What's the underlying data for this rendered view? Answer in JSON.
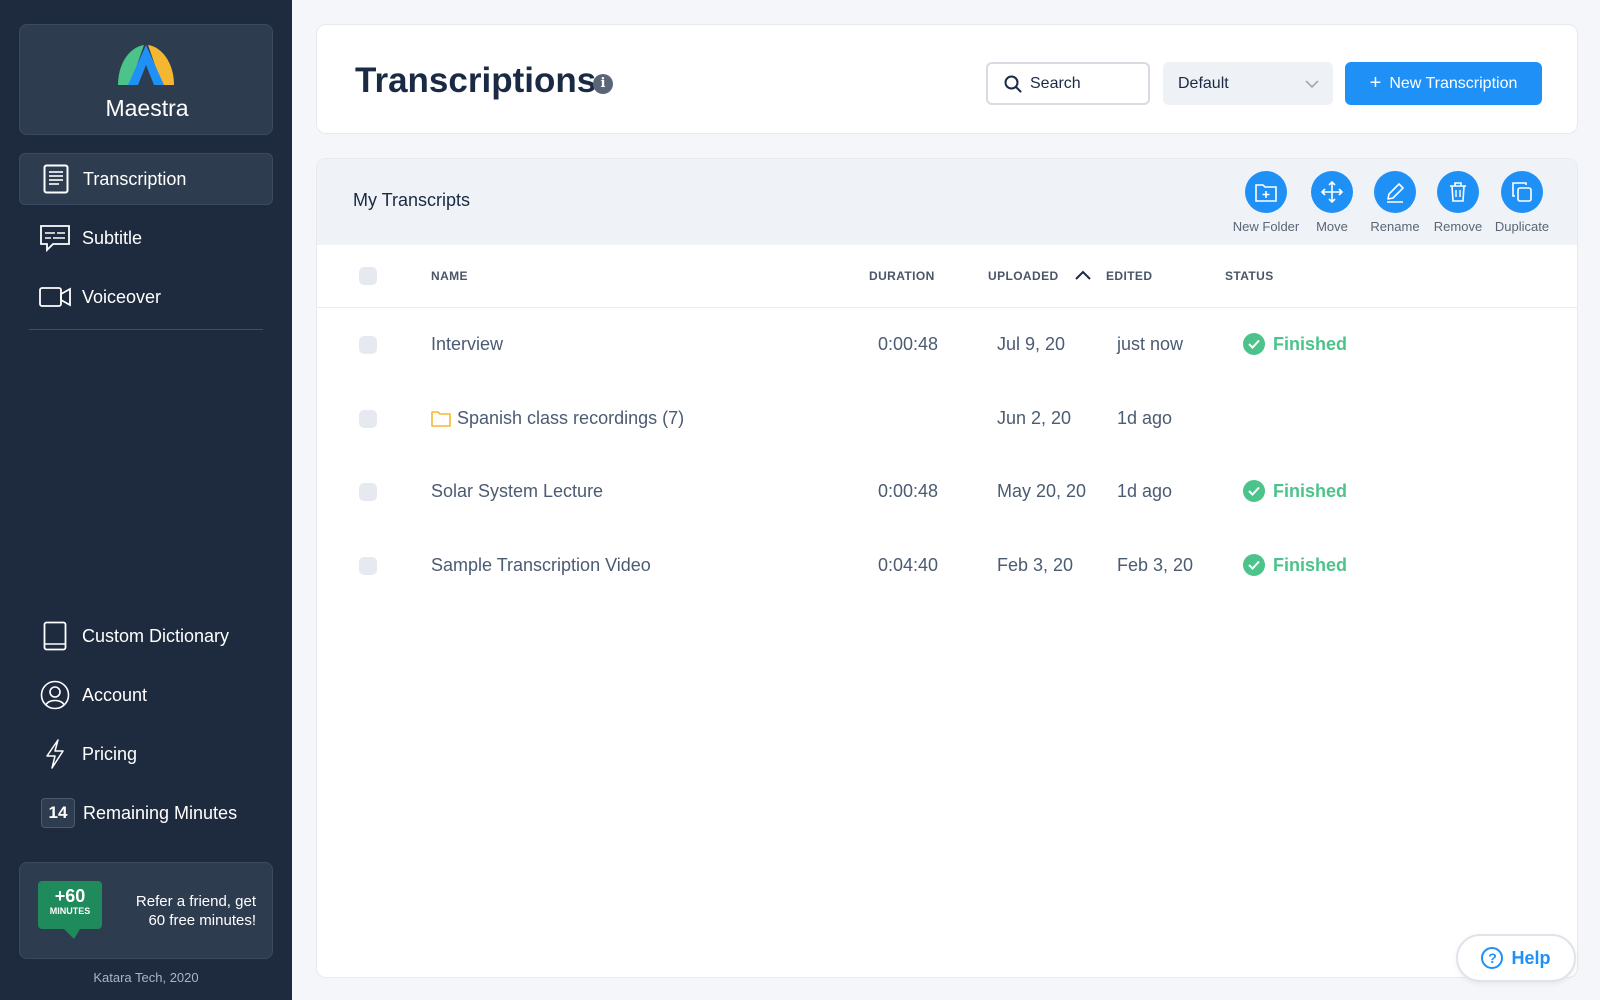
{
  "brand": {
    "name": "Maestra"
  },
  "sidebar": {
    "nav": [
      {
        "label": "Transcription",
        "icon": "document-icon",
        "active": true
      },
      {
        "label": "Subtitle",
        "icon": "subtitle-icon",
        "active": false
      },
      {
        "label": "Voiceover",
        "icon": "video-camera-icon",
        "active": false
      }
    ],
    "bottom": [
      {
        "label": "Custom Dictionary",
        "icon": "book-icon"
      },
      {
        "label": "Account",
        "icon": "user-circle-icon"
      },
      {
        "label": "Pricing",
        "icon": "lightning-icon"
      }
    ],
    "remaining": {
      "count": "14",
      "label": "Remaining Minutes"
    },
    "refer": {
      "tag_big": "+60",
      "tag_small": "MINUTES",
      "line1": "Refer a friend, get",
      "line2": "60 free minutes!"
    },
    "copyright": "Katara Tech, 2020"
  },
  "header": {
    "title": "Transcriptions",
    "info": "i",
    "search_label": "Search",
    "dropdown_value": "Default",
    "new_button": "New Transcription"
  },
  "main": {
    "title": "My Transcripts",
    "actions": [
      "New Folder",
      "Move",
      "Rename",
      "Remove",
      "Duplicate"
    ],
    "columns": {
      "name": "NAME",
      "duration": "DURATION",
      "uploaded": "UPLOADED",
      "edited": "EDITED",
      "status": "STATUS"
    },
    "rows": [
      {
        "name": "Interview",
        "folder": false,
        "duration": "0:00:48",
        "uploaded": "Jul 9, 20",
        "edited": "just now",
        "status": "Finished"
      },
      {
        "name": "Spanish class recordings (7)",
        "folder": true,
        "duration": "",
        "uploaded": "Jun 2, 20",
        "edited": "1d ago",
        "status": ""
      },
      {
        "name": "Solar System Lecture",
        "folder": false,
        "duration": "0:00:48",
        "uploaded": "May 20, 20",
        "edited": "1d ago",
        "status": "Finished"
      },
      {
        "name": "Sample Transcription Video",
        "folder": false,
        "duration": "0:04:40",
        "uploaded": "Feb 3, 20",
        "edited": "Feb 3, 20",
        "status": "Finished"
      }
    ]
  },
  "help": {
    "label": "Help"
  },
  "colors": {
    "accent": "#1e90f6",
    "sidebar": "#1e2b3e",
    "success": "#4cc38a",
    "folder": "#f5b731"
  }
}
